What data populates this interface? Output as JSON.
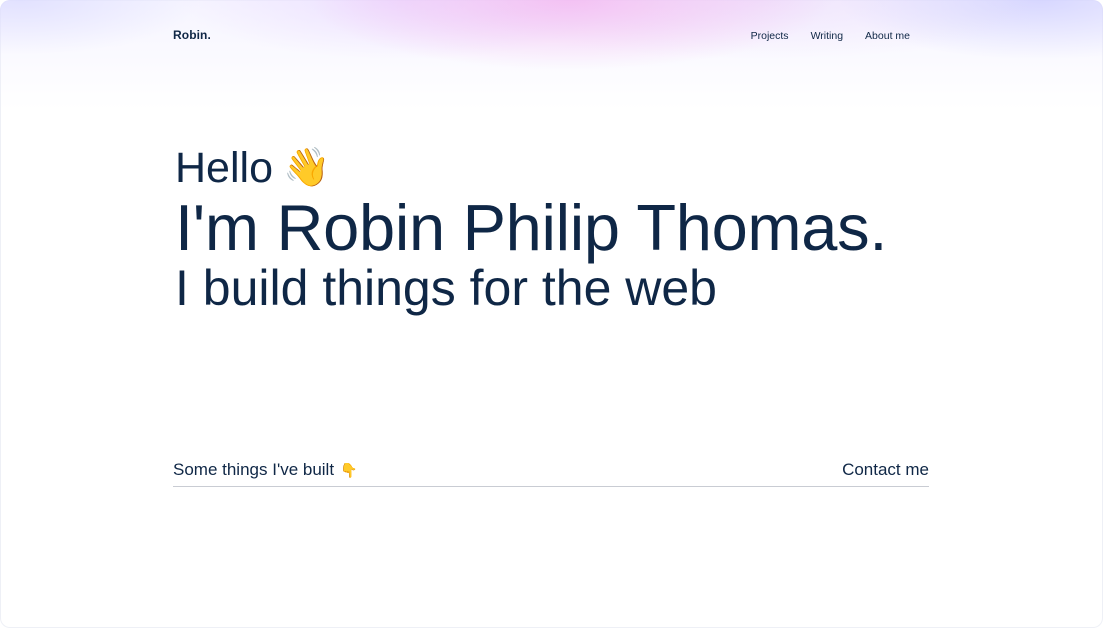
{
  "header": {
    "logo": "Robin.",
    "nav": [
      {
        "label": "Projects"
      },
      {
        "label": "Writing"
      },
      {
        "label": "About me"
      }
    ]
  },
  "hero": {
    "hello": "Hello",
    "wave_emoji": "👋",
    "name": "I'm Robin Philip Thomas.",
    "tagline": "I build things for the web"
  },
  "projects_section": {
    "title": "Some things I've built",
    "pointer_emoji": "👇",
    "contact_label": "Contact me"
  },
  "colors": {
    "text": "#0f2746",
    "divider": "#c9ccd3",
    "background": "#ffffff",
    "glow_pink": "#f4b4f0",
    "glow_lavender": "#cdcdff"
  }
}
